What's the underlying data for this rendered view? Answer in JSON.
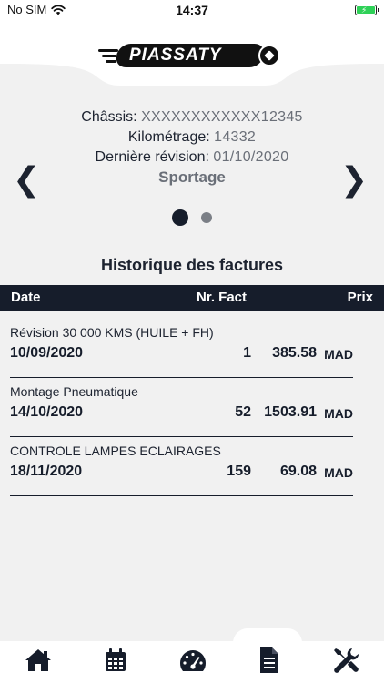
{
  "status_bar": {
    "carrier": "No SIM",
    "time": "14:37"
  },
  "brand": {
    "logo_text": "PIASSATY"
  },
  "vehicle": {
    "chassis_label": "Châssis:",
    "chassis_value": "XXXXXXXXXXXX12345",
    "mileage_label": "Kilométrage:",
    "mileage_value": "14332",
    "last_service_label": "Dernière révision:",
    "last_service_value": "01/10/2020",
    "model": "Sportage"
  },
  "carousel": {
    "prev": "❮",
    "next": "❯",
    "total_pages": 2,
    "active_page": 1
  },
  "invoices": {
    "title": "Historique des factures",
    "columns": {
      "date": "Date",
      "number": "Nr. Fact",
      "price": "Prix"
    },
    "rows": [
      {
        "description": "Révision 30 000 KMS (HUILE + FH)",
        "date": "10/09/2020",
        "number": "1",
        "amount": "385.58",
        "currency": "MAD"
      },
      {
        "description": "Montage Pneumatique",
        "date": "14/10/2020",
        "number": "52",
        "amount": "1503.91",
        "currency": "MAD"
      },
      {
        "description": "CONTROLE LAMPES ECLAIRAGES",
        "date": "18/11/2020",
        "number": "159",
        "amount": "69.08",
        "currency": "MAD"
      }
    ]
  },
  "nav": {
    "items": [
      {
        "icon": "home-icon"
      },
      {
        "icon": "calendar-icon"
      },
      {
        "icon": "speedometer-icon"
      },
      {
        "icon": "invoice-icon",
        "active": true
      },
      {
        "icon": "tools-icon"
      }
    ]
  },
  "colors": {
    "primary": "#161d2b",
    "muted": "#6a6f78",
    "background": "#f1f1f1",
    "battery": "#2fd158"
  }
}
